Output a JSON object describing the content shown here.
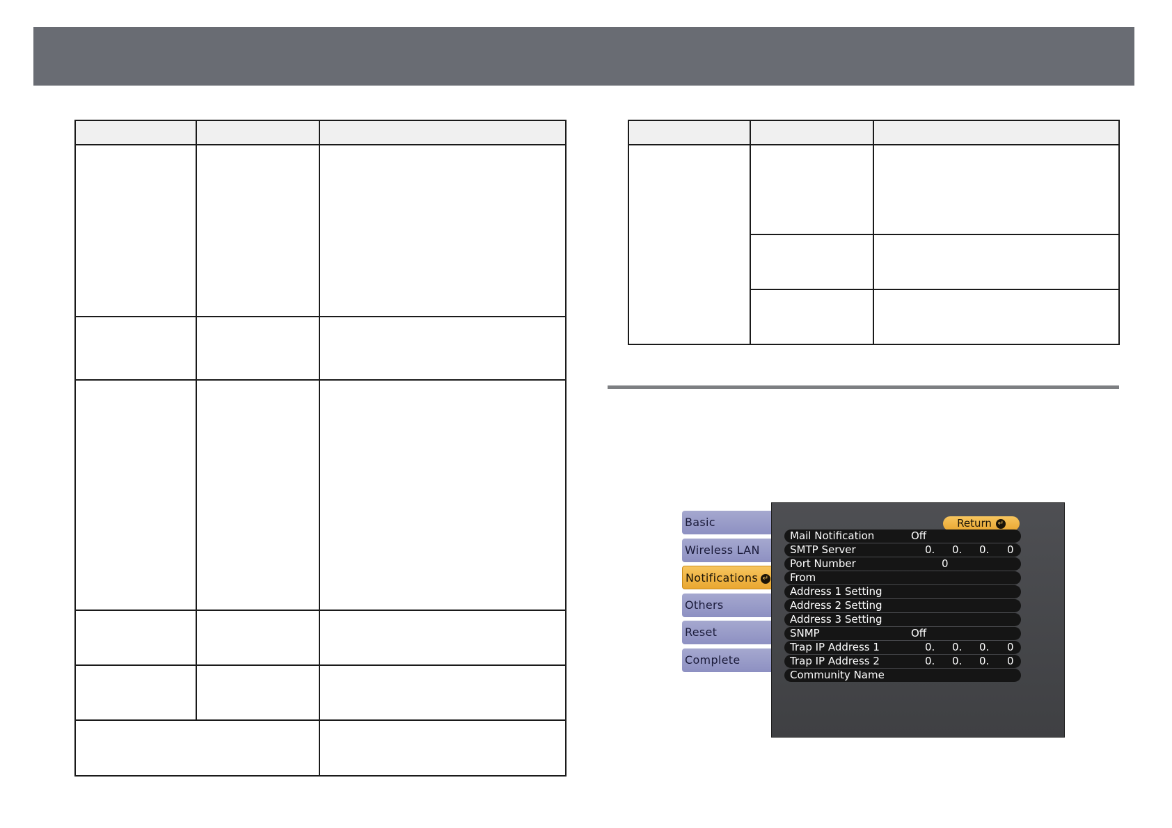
{
  "menu": {
    "tabs": [
      {
        "label": "Basic",
        "active": false
      },
      {
        "label": "Wireless LAN",
        "active": false
      },
      {
        "label": "Notifications",
        "active": true
      },
      {
        "label": "Others",
        "active": false
      },
      {
        "label": "Reset",
        "active": false
      },
      {
        "label": "Complete",
        "active": false
      }
    ],
    "return_label": "Return",
    "enter_icon": "enter-icon",
    "rows": [
      {
        "label": "Mail Notification",
        "value": "Off"
      },
      {
        "label": "SMTP Server",
        "ip": [
          "0.",
          "0.",
          "0.",
          "0"
        ]
      },
      {
        "label": "Port Number",
        "value": "0"
      },
      {
        "label": "From"
      },
      {
        "label": "Address 1 Setting"
      },
      {
        "label": "Address 2 Setting"
      },
      {
        "label": "Address 3 Setting"
      },
      {
        "label": "SNMP",
        "value": "Off"
      },
      {
        "label": "Trap IP Address 1",
        "ip": [
          "0.",
          "0.",
          "0.",
          "0"
        ]
      },
      {
        "label": "Trap IP Address 2",
        "ip": [
          "0.",
          "0.",
          "0.",
          "0"
        ]
      },
      {
        "label": "Community Name"
      }
    ]
  },
  "colors": {
    "topbar": "#696c73",
    "tab": "#9a9dc9",
    "active_tab": "#f2b94a",
    "panel": "#47484c"
  }
}
